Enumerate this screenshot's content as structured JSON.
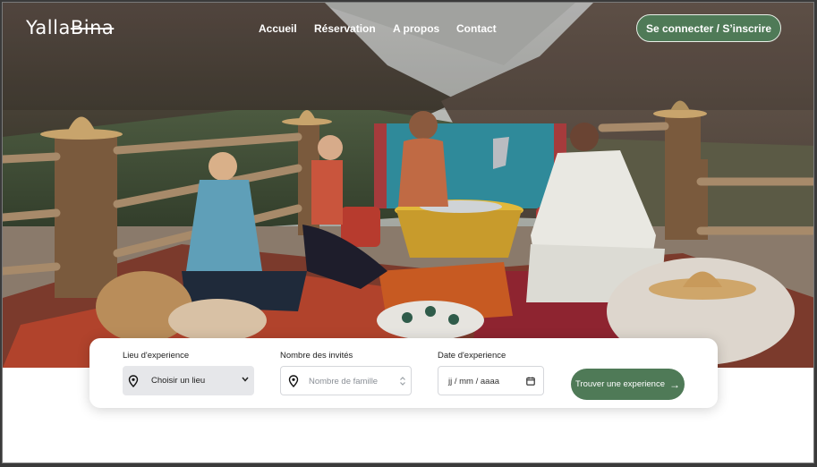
{
  "brand": {
    "logo_text_a": "Yalla",
    "logo_text_b": "Bina"
  },
  "nav": {
    "items": [
      "Accueil",
      "Réservation",
      "A propos",
      "Contact"
    ]
  },
  "auth": {
    "button_label": "Se connecter / S’inscrire"
  },
  "search": {
    "location_label": "Lieu d'experience",
    "location_value": "Choisir un lieu",
    "guests_label": "Nombre des invités",
    "guests_placeholder": "Nombre de famille",
    "date_label": "Date d'experience",
    "date_placeholder": "jj / mm / aaaa",
    "submit_label": "Trouver une experience",
    "submit_arrow": "→"
  },
  "colors": {
    "accent": "#4f7a57",
    "accent_border": "#e8efe8"
  },
  "icons": [
    "map-pin-icon",
    "chevron-down-icon",
    "stepper-icon",
    "calendar-icon",
    "arrow-right-icon"
  ]
}
